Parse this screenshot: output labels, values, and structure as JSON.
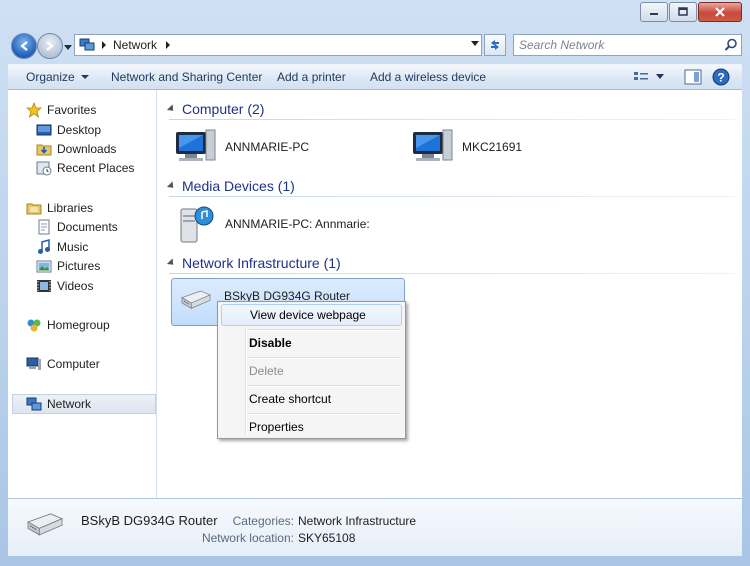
{
  "window": {
    "colors": {
      "accent": "#1e3287",
      "titlebar": "#b9d1ea",
      "close": "#c7493a"
    }
  },
  "address": {
    "location": "Network",
    "search_placeholder": "Search Network"
  },
  "toolbar": {
    "organize": "Organize",
    "network_sharing": "Network and Sharing Center",
    "add_printer": "Add a printer",
    "add_wireless": "Add a wireless device"
  },
  "sidebar": {
    "favorites": "Favorites",
    "desktop": "Desktop",
    "downloads": "Downloads",
    "recent_places": "Recent Places",
    "libraries": "Libraries",
    "documents": "Documents",
    "music": "Music",
    "pictures": "Pictures",
    "videos": "Videos",
    "homegroup": "Homegroup",
    "computer": "Computer",
    "network": "Network"
  },
  "groups": {
    "computer": "Computer (2)",
    "media": "Media Devices (1)",
    "infrastructure": "Network Infrastructure (1)"
  },
  "devices": {
    "pc1": "ANNMARIE-PC",
    "pc2": "MKC21691",
    "media1": "ANNMARIE-PC: Annmarie:",
    "router": "BSkyB DG934G Router"
  },
  "context_menu": {
    "view_webpage": "View device webpage",
    "disable": "Disable",
    "delete": "Delete",
    "create_shortcut": "Create shortcut",
    "properties": "Properties"
  },
  "details": {
    "name": "BSkyB DG934G Router",
    "categories_label": "Categories:",
    "categories_value": "Network Infrastructure",
    "location_label": "Network location:",
    "location_value": "SKY65108"
  }
}
